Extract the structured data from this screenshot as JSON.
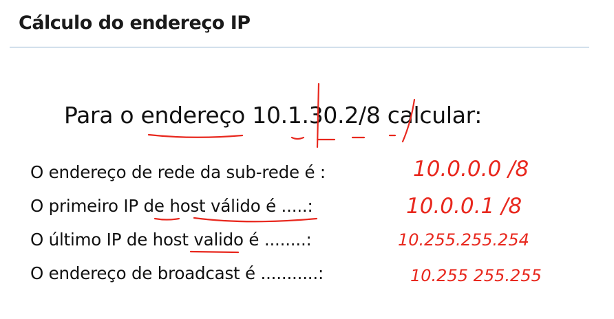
{
  "slide": {
    "title": "Cálculo do endereço IP",
    "prompt": {
      "lead": "Para o",
      "word_endereco": "endereço",
      "address": "10.1.30.2/8",
      "tail": "calcular:"
    },
    "questions": [
      {
        "text": "O endereço de rede da sub-rede é :",
        "handwritten_answer": "10.0.0.0 /8"
      },
      {
        "text": "O primeiro IP de host válido é .....:",
        "handwritten_answer": "10.0.0.1 /8"
      },
      {
        "text": "O último IP de host valido é ........:",
        "handwritten_answer": "10.255.255.254"
      },
      {
        "text": "O endereço de broadcast é ...........:",
        "handwritten_answer": "10.255 255.255"
      }
    ]
  },
  "colors": {
    "annotation_ink": "#e8281e",
    "title_rule": "#8fb0cf"
  }
}
